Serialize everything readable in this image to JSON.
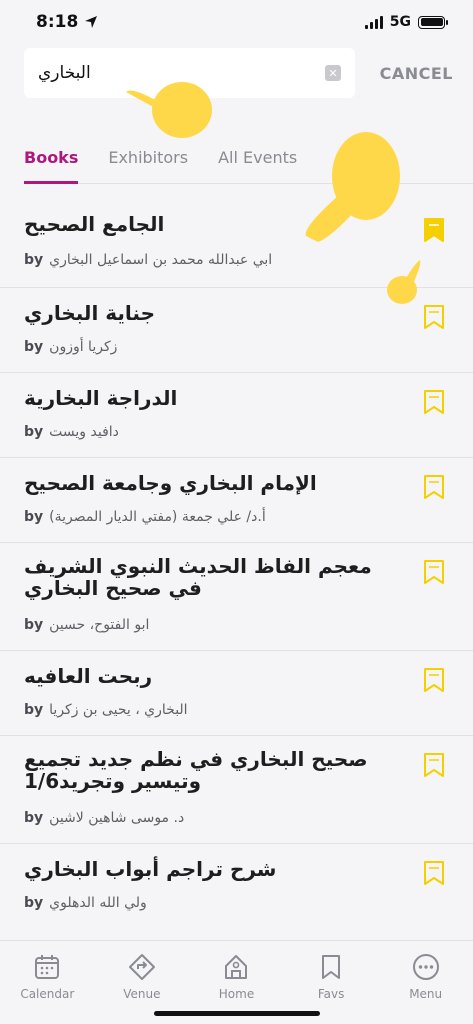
{
  "status_bar": {
    "time": "8:18",
    "network": "5G"
  },
  "search": {
    "value": "البخاري",
    "cancel_label": "CANCEL"
  },
  "tabs": [
    {
      "label": "Books"
    },
    {
      "label": "Exhibitors"
    },
    {
      "label": "All Events"
    }
  ],
  "by_label": "by",
  "books": [
    {
      "title": "الجامع الصحيح",
      "author": "ابي عبدالله محمد بن اسماعيل البخاري",
      "bookmarked": true
    },
    {
      "title": "جناية البخاري",
      "author": "زكريا أوزون",
      "bookmarked": false
    },
    {
      "title": "الدراجة البخارية",
      "author": "دافيد ويست",
      "bookmarked": false
    },
    {
      "title": "الإمام البخاري وجامعة الصحيح",
      "author": "أ.د/ علي جمعة (مفتي الديار المصرية)",
      "bookmarked": false
    },
    {
      "title": "معجم الفاظ الحديث النبوي الشريف في صحيح البخاري",
      "author": "ابو الفتوح، حسين",
      "bookmarked": false
    },
    {
      "title": "ربحت العافيه",
      "author": "البخاري ، يحيى بن زكريا",
      "bookmarked": false
    },
    {
      "title": "صحيح البخاري في نظم جديد تجميع وتيسير وتجريد1/6",
      "author": "د. موسى شاهين لاشين",
      "bookmarked": false
    },
    {
      "title": "شرح تراجم أبواب البخاري",
      "author": "ولي الله الدهلوي",
      "bookmarked": false
    }
  ],
  "tabbar": [
    {
      "label": "Calendar",
      "icon": "calendar-icon"
    },
    {
      "label": "Venue",
      "icon": "venue-icon"
    },
    {
      "label": "Home",
      "icon": "home-icon"
    },
    {
      "label": "Favs",
      "icon": "bookmark-icon"
    },
    {
      "label": "Menu",
      "icon": "menu-dots-icon"
    }
  ],
  "colors": {
    "accent": "#b0177d",
    "bookmark": "#f5d000",
    "text": "#1e1e1e",
    "muted": "#8b8b93"
  }
}
